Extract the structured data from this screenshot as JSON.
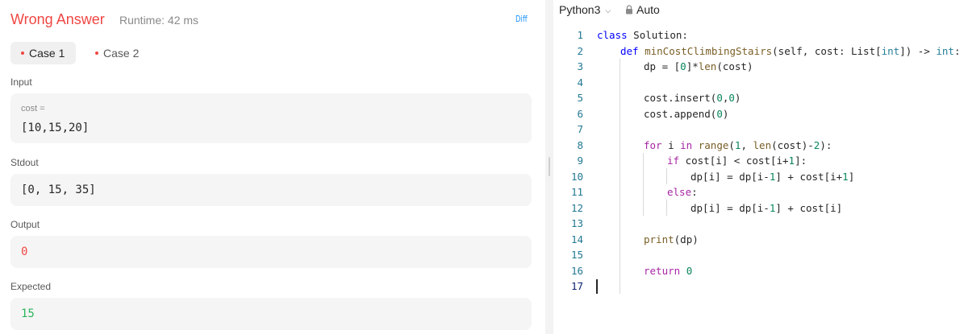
{
  "result": {
    "verdict": "Wrong Answer",
    "runtime": "Runtime: 42 ms",
    "diff_label": "Diff",
    "colors": {
      "error": "#ef4743",
      "success": "#2db55d",
      "link": "#1890ff"
    }
  },
  "cases": [
    {
      "label": "Case 1",
      "active": true
    },
    {
      "label": "Case 2",
      "active": false
    }
  ],
  "input": {
    "label": "Input",
    "param_name": "cost =",
    "param_value": "[10,15,20]"
  },
  "stdout": {
    "label": "Stdout",
    "value": "[0, 15, 35]"
  },
  "output": {
    "label": "Output",
    "value": "0"
  },
  "expected": {
    "label": "Expected",
    "value": "15"
  },
  "editor": {
    "language": "Python3",
    "mode": "Auto",
    "lines": [
      {
        "n": "1"
      },
      {
        "n": "2"
      },
      {
        "n": "3"
      },
      {
        "n": "4"
      },
      {
        "n": "5"
      },
      {
        "n": "6"
      },
      {
        "n": "7"
      },
      {
        "n": "8"
      },
      {
        "n": "9"
      },
      {
        "n": "10"
      },
      {
        "n": "11"
      },
      {
        "n": "12"
      },
      {
        "n": "13"
      },
      {
        "n": "14"
      },
      {
        "n": "15"
      },
      {
        "n": "16"
      },
      {
        "n": "17"
      }
    ],
    "code": {
      "l1_kw": "class",
      "l1_rest": " Solution:",
      "l2_kw": "def",
      "l2_fn": "minCostClimbingStairs",
      "l2_a": "(self, cost: List[",
      "l2_t1": "int",
      "l2_b": "]) -> ",
      "l2_t2": "int",
      "l2_c": ":",
      "l3_a": "dp = [",
      "l3_n": "0",
      "l3_b": "]*",
      "l3_fn": "len",
      "l3_c": "(cost)",
      "l5_a": "cost.insert(",
      "l5_n1": "0",
      "l5_b": ",",
      "l5_n2": "0",
      "l5_c": ")",
      "l6_a": "cost.append(",
      "l6_n": "0",
      "l6_b": ")",
      "l8_kw1": "for",
      "l8_a": " i ",
      "l8_kw2": "in",
      "l8_b": " ",
      "l8_fn1": "range",
      "l8_c": "(",
      "l8_n1": "1",
      "l8_d": ", ",
      "l8_fn2": "len",
      "l8_e": "(cost)-",
      "l8_n2": "2",
      "l8_f": "):",
      "l9_kw": "if",
      "l9_a": " cost[i] < cost[i+",
      "l9_n": "1",
      "l9_b": "]:",
      "l10_a": "dp[i] = dp[i-",
      "l10_n1": "1",
      "l10_b": "] + cost[i+",
      "l10_n2": "1",
      "l10_c": "]",
      "l11_kw": "else",
      "l11_a": ":",
      "l12_a": "dp[i] = dp[i-",
      "l12_n": "1",
      "l12_b": "] + cost[i]",
      "l14_fn": "print",
      "l14_a": "(dp)",
      "l16_kw": "return",
      "l16_a": " ",
      "l16_n": "0"
    }
  }
}
